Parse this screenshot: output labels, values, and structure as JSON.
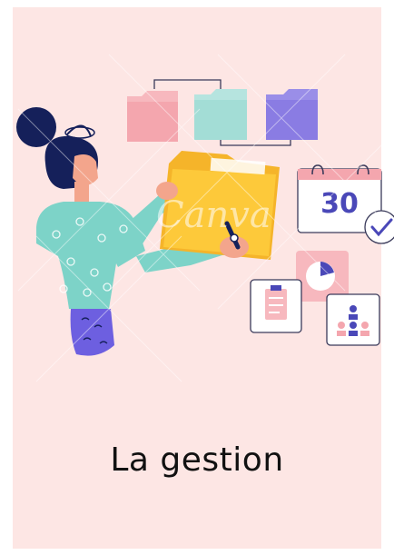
{
  "card": {
    "caption": "La gestion",
    "watermark": "Canva",
    "background_color": "#fde6e4"
  },
  "calendar": {
    "day": "30"
  },
  "icons": [
    "folder-icon",
    "calendar-icon",
    "checkmark-icon",
    "pie-chart-icon",
    "clipboard-icon",
    "team-icon",
    "pen-icon"
  ],
  "colors": {
    "accent_blue": "#4a48b8",
    "folder_yellow": "#fdc93a",
    "shirt_teal": "#7dd3c8",
    "skirt_purple": "#6d5fe0",
    "hair_navy": "#15205a"
  }
}
